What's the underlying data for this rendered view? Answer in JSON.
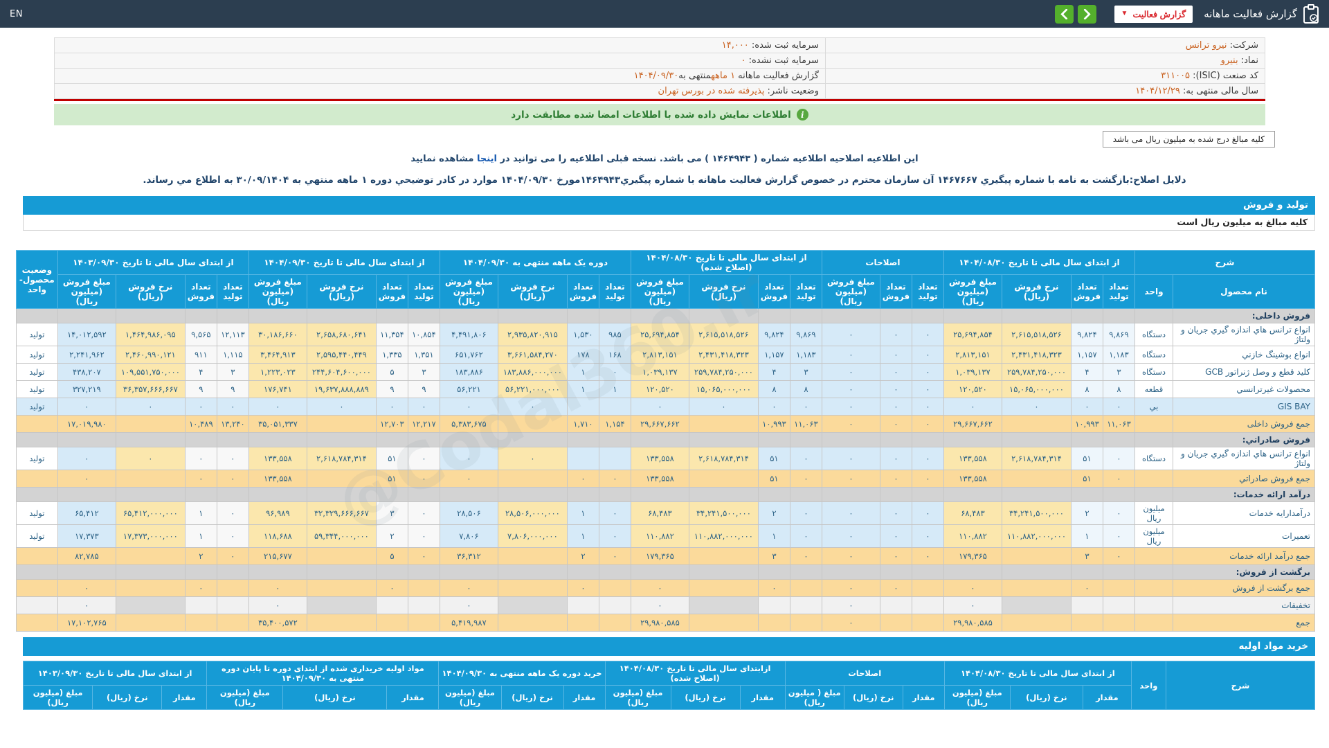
{
  "colors": {
    "topbar": "#2c3e50",
    "accent_blue": "#169bd5",
    "accent_green": "#54b02c",
    "accent_red": "#d9262c",
    "notice_green_bg": "#d2ebcd",
    "cell_blue": "#d6eaf8",
    "cell_yellow": "#fbe7ad",
    "total_row": "#fbda9b",
    "value_orange": "#c9611f"
  },
  "top_bar": {
    "lang": "EN",
    "title": "گزارش فعالیت ماهانه",
    "filter_button": "گزارش فعالیت",
    "caret": "▼",
    "prev_icon": "❮",
    "next_icon": "❯",
    "report_icon": "clipboard-report-icon"
  },
  "watermark": "@Codal360.ir",
  "info": {
    "rows": [
      {
        "right": [
          {
            "t": "شرکت: "
          },
          {
            "t": "نیرو ترانس",
            "hl": true
          }
        ],
        "left": [
          {
            "t": "سرمایه ثبت شده: "
          },
          {
            "t": "۱۴,۰۰۰",
            "hl": true
          }
        ]
      },
      {
        "right": [
          {
            "t": "نماد: "
          },
          {
            "t": "بنیرو",
            "hl": true
          }
        ],
        "left": [
          {
            "t": "سرمایه ثبت نشده: "
          },
          {
            "t": "۰",
            "hl": true
          }
        ]
      },
      {
        "right": [
          {
            "t": "کد صنعت (ISIC): "
          },
          {
            "t": "۳۱۱۰۰۵",
            "hl": true
          }
        ],
        "left": [
          {
            "t": "گزارش فعالیت ماهانه "
          },
          {
            "t": "۱ ماهه",
            "hl": true
          },
          {
            "t": "منتهی به"
          },
          {
            "t": "۱۴۰۴/۰۹/۳۰",
            "hl": true
          }
        ]
      },
      {
        "right": [
          {
            "t": "سال مالی منتهی به: "
          },
          {
            "t": "۱۴۰۴/۱۲/۲۹",
            "hl": true
          }
        ],
        "left": [
          {
            "t": "وضعیت ناشر: "
          },
          {
            "t": "پذیرفته شده در بورس تهران",
            "hl": true
          }
        ]
      }
    ]
  },
  "notice": {
    "icon": "info-icon",
    "text": "اطلاعات نمایش داده شده با اطلاعات امضا شده مطابقت دارد"
  },
  "amount_note": "کلیه مبالغ درج شده به میلیون ریال می باشد",
  "p1": {
    "before": "این اطلاعیه اصلاحیه اطلاعیه شماره ( ۱۴۶۴۹۴۳ ) می باشد. نسخه قبلی اطلاعیه را می توانید در ",
    "link": "اینجا",
    "after": " مشاهده نمایید"
  },
  "p2": "دلایل اصلاح:بازگشت به نامه با شماره پیگیري ۱۴۶۷۶۶۷ آن سازمان محترم در خصوص گزارش فعالیت ماهانه با شماره پیگیري۱۴۶۴۹۴۳مورخ ۱۴۰۴/۰۹/۳۰ موارد در کادر توضیحي دوره ۱ ماهه منتهي به ۳۰/۰۹/۱۴۰۴ به اطلاع مي رساند.",
  "section1": {
    "title": "تولید و فروش",
    "subtitle": "کلیه مبالغ به میلیون ریال است"
  },
  "section2": {
    "title": "خرید مواد اولیه"
  },
  "sales_table": {
    "sharh": "شرح",
    "name_col": "نام محصول",
    "unit_col": "واحد",
    "status_col": "وضعیت محصول-واحد",
    "groups": [
      {
        "label": "از ابتدای سال مالی تا تاریخ ۱۴۰۴/۰۸/۳۰",
        "cols": [
          "تعداد تولید",
          "تعداد فروش",
          "نرخ فروش (ریال)",
          "مبلغ فروش (میلیون ریال)"
        ]
      },
      {
        "label": "اصلاحات",
        "cols": [
          "تعداد تولید",
          "تعداد فروش",
          "مبلغ فروش (میلیون ریال)"
        ]
      },
      {
        "label": "از ابتدای سال مالی تا تاریخ ۱۴۰۴/۰۸/۳۰ (اصلاح شده)",
        "cols": [
          "تعداد تولید",
          "تعداد فروش",
          "نرخ فروش (ریال)",
          "مبلغ فروش (میلیون ریال)"
        ]
      },
      {
        "label": "دوره یک ماهه منتهی به ۱۴۰۴/۰۹/۳۰",
        "cols": [
          "تعداد تولید",
          "تعداد فروش",
          "نرخ فروش (ریال)",
          "مبلغ فروش (میلیون ریال)"
        ]
      },
      {
        "label": "از ابتدای سال مالی تا تاریخ ۱۴۰۴/۰۹/۳۰",
        "cols": [
          "تعداد تولید",
          "تعداد فروش",
          "نرخ فروش (ریال)",
          "مبلغ فروش (میلیون ریال)"
        ]
      },
      {
        "label": "از ابتدای سال مالی تا تاریخ ۱۴۰۳/۰۹/۳۰",
        "cols": [
          "تعداد تولید",
          "تعداد فروش",
          "نرخ فروش (ریال)",
          "مبلغ فروش (میلیون ریال)"
        ]
      }
    ],
    "rows": [
      {
        "variant": "section",
        "name": "فروش داخلی:"
      },
      {
        "variant": "normal",
        "name": "انواع ترانس هاي اندازه گیري جریان و ولتاژ",
        "unit": "دستگاه",
        "status": "تولید",
        "cells": [
          "۹,۸۶۹",
          "۹,۸۲۴",
          "۲,۶۱۵,۵۱۸,۵۲۶",
          "۲۵,۶۹۴,۸۵۴",
          "۰",
          "۰",
          "۰",
          "۹,۸۶۹",
          "۹,۸۲۴",
          "۲,۶۱۵,۵۱۸,۵۲۶",
          "۲۵,۶۹۴,۸۵۴",
          "۹۸۵",
          "۱,۵۳۰",
          "۲,۹۳۵,۸۲۰,۹۱۵",
          "۴,۴۹۱,۸۰۶",
          "۱۰,۸۵۴",
          "۱۱,۳۵۴",
          "۲,۶۵۸,۶۸۰,۶۴۱",
          "۳۰,۱۸۶,۶۶۰",
          "۱۲,۱۱۳",
          "۹,۵۶۵",
          "۱,۴۶۴,۹۸۶,۰۹۵",
          "۱۴,۰۱۲,۵۹۲"
        ]
      },
      {
        "variant": "normal",
        "name": "انواع بوشینگ خازني",
        "unit": "دستگاه",
        "status": "تولید",
        "cells": [
          "۱,۱۸۳",
          "۱,۱۵۷",
          "۲,۴۳۱,۴۱۸,۳۲۳",
          "۲,۸۱۳,۱۵۱",
          "۰",
          "۰",
          "۰",
          "۱,۱۸۳",
          "۱,۱۵۷",
          "۲,۴۳۱,۴۱۸,۳۲۳",
          "۲,۸۱۳,۱۵۱",
          "۱۶۸",
          "۱۷۸",
          "۳,۶۶۱,۵۸۴,۲۷۰",
          "۶۵۱,۷۶۲",
          "۱,۳۵۱",
          "۱,۳۳۵",
          "۲,۵۹۵,۴۴۰,۴۴۹",
          "۳,۴۶۴,۹۱۳",
          "۱,۱۱۵",
          "۹۱۱",
          "۲,۴۶۰,۹۹۰,۱۲۱",
          "۲,۲۴۱,۹۶۲"
        ]
      },
      {
        "variant": "normal",
        "name": "کلید قطع و وصل ژنراتور GCB",
        "unit": "دستگاه",
        "status": "تولید",
        "cells": [
          "۳",
          "۴",
          "۲۵۹,۷۸۴,۲۵۰,۰۰۰",
          "۱,۰۳۹,۱۳۷",
          "۰",
          "۰",
          "۰",
          "۳",
          "۴",
          "۲۵۹,۷۸۴,۲۵۰,۰۰۰",
          "۱,۰۳۹,۱۳۷",
          "۰",
          "۱",
          "۱۸۳,۸۸۶,۰۰۰,۰۰۰",
          "۱۸۳,۸۸۶",
          "۳",
          "۵",
          "۲۴۴,۶۰۴,۶۰۰,۰۰۰",
          "۱,۲۲۳,۰۲۳",
          "۳",
          "۴",
          "۱۰۹,۵۵۱,۷۵۰,۰۰۰",
          "۴۳۸,۲۰۷"
        ]
      },
      {
        "variant": "normal",
        "name": "محصولات غیرترانسي",
        "unit": "قطعه",
        "status": "تولید",
        "cells": [
          "۸",
          "۸",
          "۱۵,۰۶۵,۰۰۰,۰۰۰",
          "۱۲۰,۵۲۰",
          "۰",
          "۰",
          "۰",
          "۸",
          "۸",
          "۱۵,۰۶۵,۰۰۰,۰۰۰",
          "۱۲۰,۵۲۰",
          "۱",
          "۱",
          "۵۶,۲۲۱,۰۰۰,۰۰۰",
          "۵۶,۲۲۱",
          "۹",
          "۹",
          "۱۹,۶۳۷,۸۸۸,۸۸۹",
          "۱۷۶,۷۴۱",
          "۹",
          "۹",
          "۳۶,۳۵۷,۶۶۶,۶۶۷",
          "۳۲۷,۲۱۹"
        ]
      },
      {
        "variant": "blue",
        "name": "GIS BAY",
        "unit": "بي",
        "status": "تولید",
        "cells": [
          "۰",
          "۰",
          "۰",
          "۰",
          "۰",
          "۰",
          "۰",
          "۰",
          "۰",
          "۰",
          "۰",
          "",
          "",
          "۰",
          "۰",
          "۰",
          "۰",
          "۰",
          "۰",
          "۰",
          "۰",
          "۰",
          "۰"
        ]
      },
      {
        "variant": "total",
        "name": "جمع فروش داخلی",
        "unit": "",
        "status": "",
        "cells": [
          "۱۱,۰۶۳",
          "۱۰,۹۹۳",
          "",
          "۲۹,۶۶۷,۶۶۲",
          "۰",
          "۰",
          "۰",
          "۱۱,۰۶۳",
          "۱۰,۹۹۳",
          "",
          "۲۹,۶۶۷,۶۶۲",
          "۱,۱۵۴",
          "۱,۷۱۰",
          "",
          "۵,۳۸۳,۶۷۵",
          "۱۲,۲۱۷",
          "۱۲,۷۰۳",
          "",
          "۳۵,۰۵۱,۳۳۷",
          "۱۳,۲۴۰",
          "۱۰,۴۸۹",
          "",
          "۱۷,۰۱۹,۹۸۰"
        ]
      },
      {
        "variant": "section",
        "name": "فروش صادراتي:"
      },
      {
        "variant": "normal",
        "name": "انواع ترانس هاي اندازه گیري جریان و ولتاژ",
        "unit": "دستگاه",
        "status": "تولید",
        "cells": [
          "۰",
          "۵۱",
          "۲,۶۱۸,۷۸۴,۳۱۴",
          "۱۳۳,۵۵۸",
          "۰",
          "۰",
          "۰",
          "۰",
          "۵۱",
          "۲,۶۱۸,۷۸۴,۳۱۴",
          "۱۳۳,۵۵۸",
          "",
          "",
          "۰",
          "۰",
          "۰",
          "۵۱",
          "۲,۶۱۸,۷۸۴,۳۱۴",
          "۱۳۳,۵۵۸",
          "۰",
          "۰",
          "۰",
          "۰"
        ]
      },
      {
        "variant": "total",
        "name": "جمع فروش صادراتي",
        "unit": "",
        "status": "",
        "cells": [
          "۰",
          "۵۱",
          "",
          "۱۳۳,۵۵۸",
          "۰",
          "۰",
          "۰",
          "۰",
          "۵۱",
          "",
          "۱۳۳,۵۵۸",
          "۰",
          "۰",
          "",
          "۰",
          "۰",
          "۵۱",
          "",
          "۱۳۳,۵۵۸",
          "۰",
          "۰",
          "",
          "۰"
        ]
      },
      {
        "variant": "section",
        "name": "درآمد ارائه خدمات:"
      },
      {
        "variant": "normal",
        "name": "درآمدارایه خدمات",
        "unit": "میلیون ریال",
        "status": "تولید",
        "cells": [
          "۰",
          "۲",
          "۳۴,۲۴۱,۵۰۰,۰۰۰",
          "۶۸,۴۸۳",
          "۰",
          "۰",
          "۰",
          "۰",
          "۲",
          "۳۴,۲۴۱,۵۰۰,۰۰۰",
          "۶۸,۴۸۳",
          "۰",
          "۱",
          "۲۸,۵۰۶,۰۰۰,۰۰۰",
          "۲۸,۵۰۶",
          "۰",
          "۳",
          "۳۲,۳۲۹,۶۶۶,۶۶۷",
          "۹۶,۹۸۹",
          "۰",
          "۱",
          "۶۵,۴۱۲,۰۰۰,۰۰۰",
          "۶۵,۴۱۲"
        ]
      },
      {
        "variant": "normal",
        "name": "تعمیرات",
        "unit": "میلیون ریال",
        "status": "تولید",
        "cells": [
          "۰",
          "۱",
          "۱۱۰,۸۸۲,۰۰۰,۰۰۰",
          "۱۱۰,۸۸۲",
          "۰",
          "۰",
          "۰",
          "۰",
          "۱",
          "۱۱۰,۸۸۲,۰۰۰,۰۰۰",
          "۱۱۰,۸۸۲",
          "۰",
          "۱",
          "۷,۸۰۶,۰۰۰,۰۰۰",
          "۷,۸۰۶",
          "۰",
          "۲",
          "۵۹,۳۴۴,۰۰۰,۰۰۰",
          "۱۱۸,۶۸۸",
          "۰",
          "۱",
          "۱۷,۳۷۳,۰۰۰,۰۰۰",
          "۱۷,۳۷۳"
        ]
      },
      {
        "variant": "total",
        "name": "جمع درآمد ارائه خدمات",
        "unit": "",
        "status": "",
        "cells": [
          "۰",
          "۳",
          "",
          "۱۷۹,۳۶۵",
          "۰",
          "۰",
          "۰",
          "۰",
          "۳",
          "",
          "۱۷۹,۳۶۵",
          "۰",
          "۲",
          "",
          "۳۶,۳۱۲",
          "۰",
          "۵",
          "",
          "۲۱۵,۶۷۷",
          "۰",
          "۲",
          "",
          "۸۲,۷۸۵"
        ]
      },
      {
        "variant": "section",
        "name": "برگشت از فروش:"
      },
      {
        "variant": "total",
        "name": "جمع برگشت از فروش",
        "unit": "",
        "status": "",
        "cells": [
          "",
          "۰",
          "",
          "۰",
          "",
          "۰",
          "۰",
          "",
          "۰",
          "",
          "۰",
          "",
          "۰",
          "",
          "۰",
          "",
          "۰",
          "",
          "۰",
          "",
          "۰",
          "",
          "۰"
        ]
      },
      {
        "variant": "muted",
        "name": "تخفیفات",
        "unit": "",
        "status": "",
        "cells": [
          "",
          "",
          "",
          "۰",
          "",
          "",
          "۰",
          "",
          "",
          "",
          "۰",
          "",
          "",
          "",
          "۰",
          "",
          "",
          "",
          "۰",
          "",
          "",
          "",
          "۰"
        ]
      },
      {
        "variant": "total",
        "name": "جمع",
        "unit": "",
        "status": "",
        "cells": [
          "",
          "",
          "",
          "۲۹,۹۸۰,۵۸۵",
          "",
          "",
          "۰",
          "",
          "",
          "",
          "۲۹,۹۸۰,۵۸۵",
          "",
          "",
          "",
          "۵,۴۱۹,۹۸۷",
          "",
          "",
          "",
          "۳۵,۴۰۰,۵۷۲",
          "",
          "",
          "",
          "۱۷,۱۰۲,۷۶۵"
        ]
      }
    ]
  },
  "purchase_table": {
    "sharh": "شرح",
    "unit_col": "واحد",
    "groups": [
      {
        "label": "از ابتدای سال مالی تا تاریخ ۱۴۰۴/۰۸/۳۰",
        "cols": [
          "مقدار",
          "نرخ (ریال)",
          "مبلغ (میلیون ریال)"
        ]
      },
      {
        "label": "اصلاحات",
        "cols": [
          "مقدار",
          "نرخ (ریال)",
          "مبلغ ( میلیون ریال)"
        ]
      },
      {
        "label": "ازابتدای سال مالی تا تاریخ ۱۴۰۴/۰۸/۳۰ (اصلاح شده)",
        "cols": [
          "مقدار",
          "نرخ (ریال)",
          "مبلغ (میلیون ریال)"
        ]
      },
      {
        "label": "خرید دوره یک ماهه منتهی به ۱۴۰۴/۰۹/۳۰",
        "cols": [
          "مقدار",
          "نرخ (ریال)",
          "مبلغ (میلیون ریال)"
        ]
      },
      {
        "label": "مواد اولیه خریداری شده از ابتدای دوره تا پایان دوره منتهی به ۱۴۰۴/۰۹/۳۰",
        "cols": [
          "مقدار",
          "نرخ (ریال)",
          "مبلغ (میلیون ریال)"
        ]
      },
      {
        "label": "از ابتدای سال مالی تا تاریخ ۱۴۰۳/۰۹/۳۰",
        "cols": [
          "مقدار",
          "نرخ (ریال)",
          "مبلغ (میلیون ریال)"
        ]
      }
    ]
  }
}
